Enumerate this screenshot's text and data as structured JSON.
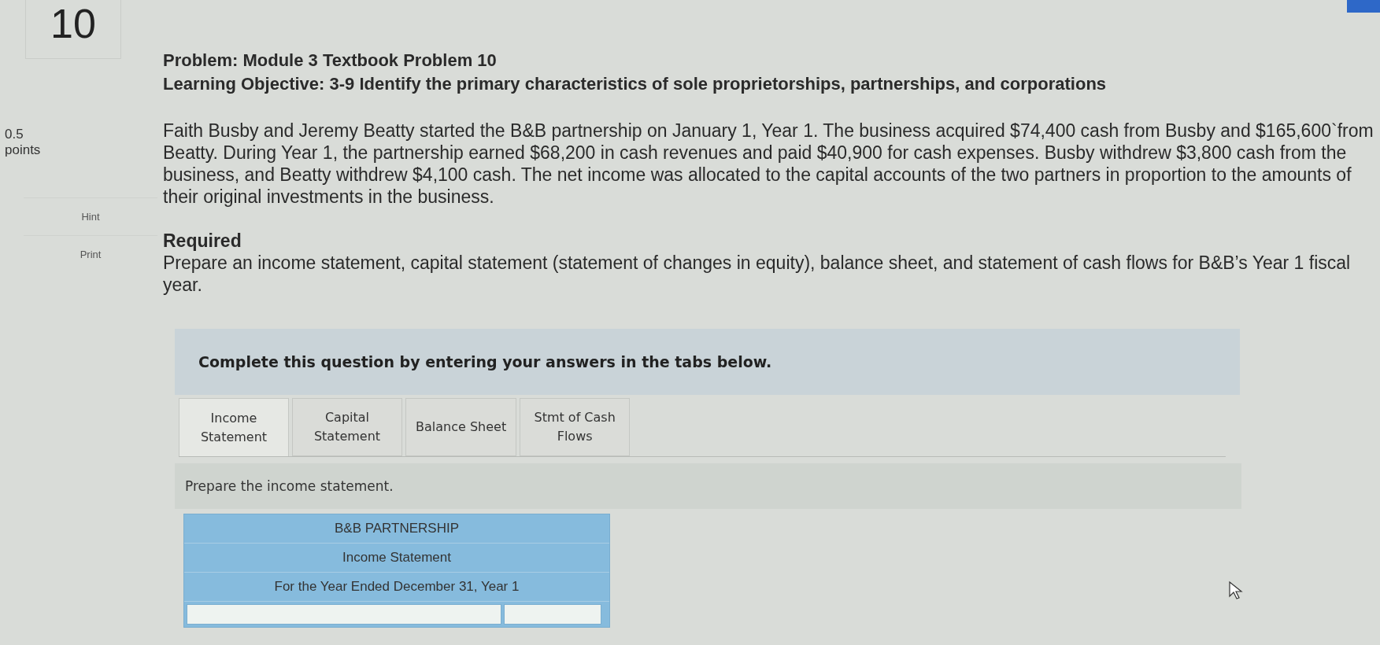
{
  "question": {
    "number": "10",
    "points_value": "0.5",
    "points_label": "points",
    "side_buttons": [
      "Hint",
      "Print"
    ]
  },
  "problem": {
    "title": "Problem: Module 3 Textbook Problem 10",
    "objective": "Learning Objective: 3-9 Identify the primary characteristics of sole proprietorships, partnerships, and corporations",
    "paragraph": "Faith Busby and Jeremy Beatty started the B&B partnership on January 1, Year 1. The business acquired $74,400 cash from Busby and $165,600`from Beatty. During Year 1, the partnership earned $68,200 in cash revenues and paid $40,900 for cash expenses. Busby withdrew $3,800 cash from the business, and Beatty withdrew $4,100 cash. The net income was allocated to the capital accounts of the two partners in proportion to the amounts of their original investments in the business.",
    "required_heading": "Required",
    "required_text": "Prepare an income statement, capital statement (statement of changes in equity), balance sheet, and statement of cash flows for B&B’s Year 1 fiscal year."
  },
  "instruction": "Complete this question by entering your answers in the tabs below.",
  "tabs": [
    {
      "label": "Income\nStatement",
      "selected": true
    },
    {
      "label": "Capital\nStatement",
      "selected": false
    },
    {
      "label": "Balance Sheet",
      "selected": false
    },
    {
      "label": "Stmt of Cash\nFlows",
      "selected": false
    }
  ],
  "tab_prompt": "Prepare the income statement.",
  "statement": {
    "header_lines": [
      "B&B PARTNERSHIP",
      "Income Statement",
      "For the Year Ended December 31, Year 1"
    ],
    "inputs": [
      {
        "kind": "label"
      },
      {
        "kind": "amount"
      }
    ]
  }
}
